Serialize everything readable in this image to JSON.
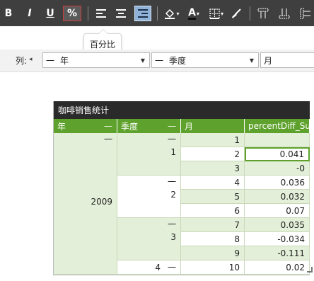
{
  "toolbar": {
    "bold_label": "B",
    "italic_label": "I",
    "underline_label": "U",
    "percent_label": "%",
    "text_color_label": "A",
    "dropdown_caret": "▾"
  },
  "tooltip": {
    "text": "百分比"
  },
  "column_band": {
    "label": "列:",
    "arrow": "◂",
    "dropdowns": [
      {
        "dash": "一",
        "value": "年"
      },
      {
        "dash": "一",
        "value": "季度"
      },
      {
        "dash": "",
        "value": "月"
      }
    ]
  },
  "pivot": {
    "title": "咖啡销售统计",
    "headers": [
      "年",
      "季度",
      "月",
      "percentDiff_Su"
    ],
    "collapse_glyph": "一",
    "year": "2009",
    "quarters": [
      "1",
      "2",
      "3",
      "4"
    ],
    "months": [
      "1",
      "2",
      "3",
      "4",
      "5",
      "6",
      "7",
      "8",
      "9",
      "10"
    ],
    "values": [
      "",
      "0.041",
      "-0",
      "0.036",
      "0.032",
      "0.07",
      "0.035",
      "-0.034",
      "-0.111",
      "0.02"
    ]
  },
  "colors": {
    "toolbar_bg": "#3f3f3f",
    "header_green": "#5ea12c",
    "cell_green": "#e3efd8",
    "title_bg": "#2a2a2a",
    "selected_border": "#d23b3b"
  }
}
